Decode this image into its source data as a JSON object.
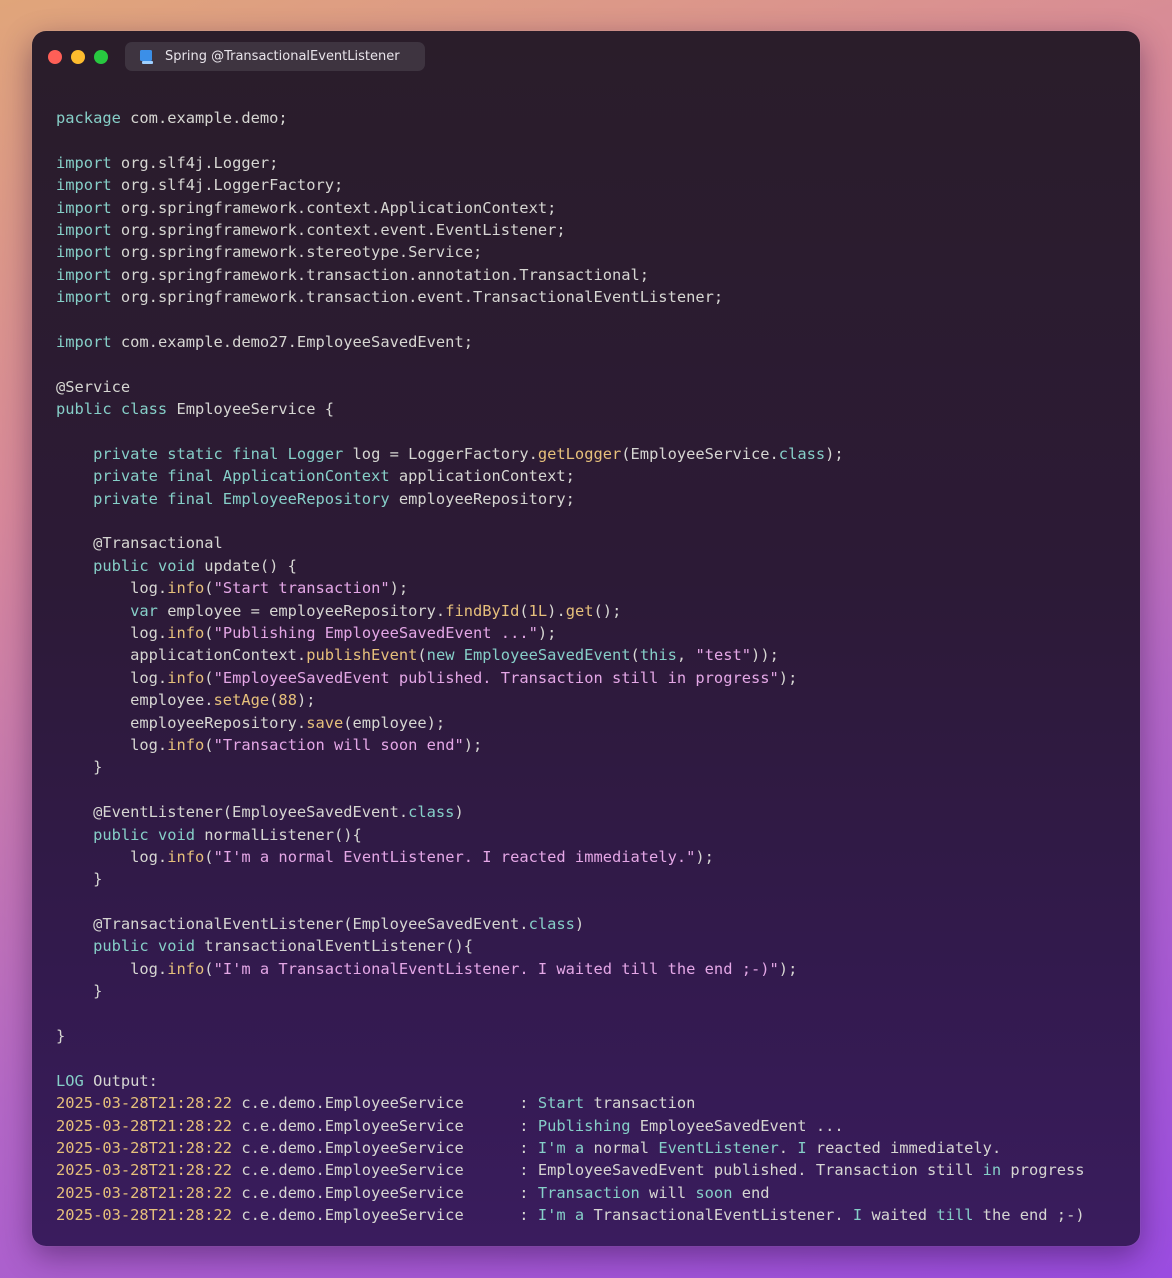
{
  "window": {
    "tab_title": "Spring @TransactionalEventListener",
    "tab_icon": "document-icon"
  },
  "code_lines": [
    [
      [
        "k",
        "package"
      ],
      [
        "n",
        " com.example.demo;"
      ]
    ],
    [],
    [
      [
        "k",
        "import"
      ],
      [
        "n",
        " org.slf4j.Logger;"
      ]
    ],
    [
      [
        "k",
        "import"
      ],
      [
        "n",
        " org.slf4j.LoggerFactory;"
      ]
    ],
    [
      [
        "k",
        "import"
      ],
      [
        "n",
        " org.springframework.context.ApplicationContext;"
      ]
    ],
    [
      [
        "k",
        "import"
      ],
      [
        "n",
        " org.springframework.context.event.EventListener;"
      ]
    ],
    [
      [
        "k",
        "import"
      ],
      [
        "n",
        " org.springframework.stereotype.Service;"
      ]
    ],
    [
      [
        "k",
        "import"
      ],
      [
        "n",
        " org.springframework.transaction.annotation.Transactional;"
      ]
    ],
    [
      [
        "k",
        "import"
      ],
      [
        "n",
        " org.springframework.transaction.event.TransactionalEventListener;"
      ]
    ],
    [],
    [
      [
        "k",
        "import"
      ],
      [
        "n",
        " com.example.demo27.EmployeeSavedEvent;"
      ]
    ],
    [],
    [
      [
        "n",
        "@Service"
      ]
    ],
    [
      [
        "k",
        "public class"
      ],
      [
        "n",
        " EmployeeService {"
      ]
    ],
    [],
    [
      [
        "n",
        "    "
      ],
      [
        "k",
        "private static final Logger"
      ],
      [
        "n",
        " log = LoggerFactory."
      ],
      [
        "m",
        "getLogger"
      ],
      [
        "n",
        "(EmployeeService."
      ],
      [
        "k",
        "class"
      ],
      [
        "n",
        ");"
      ]
    ],
    [
      [
        "n",
        "    "
      ],
      [
        "k",
        "private final ApplicationContext"
      ],
      [
        "n",
        " applicationContext;"
      ]
    ],
    [
      [
        "n",
        "    "
      ],
      [
        "k",
        "private final EmployeeRepository"
      ],
      [
        "n",
        " employeeRepository;"
      ]
    ],
    [],
    [
      [
        "n",
        "    @Transactional"
      ]
    ],
    [
      [
        "n",
        "    "
      ],
      [
        "k",
        "public void"
      ],
      [
        "n",
        " update() {"
      ]
    ],
    [
      [
        "n",
        "        log."
      ],
      [
        "m",
        "info"
      ],
      [
        "n",
        "("
      ],
      [
        "s",
        "\"Start transaction\""
      ],
      [
        "n",
        ");"
      ]
    ],
    [
      [
        "n",
        "        "
      ],
      [
        "k",
        "var"
      ],
      [
        "n",
        " employee = employeeRepository."
      ],
      [
        "m",
        "findById"
      ],
      [
        "n",
        "("
      ],
      [
        "m",
        "1L"
      ],
      [
        "n",
        ")."
      ],
      [
        "m",
        "get"
      ],
      [
        "n",
        "();"
      ]
    ],
    [
      [
        "n",
        "        log."
      ],
      [
        "m",
        "info"
      ],
      [
        "n",
        "("
      ],
      [
        "s",
        "\"Publishing EmployeeSavedEvent ...\""
      ],
      [
        "n",
        ");"
      ]
    ],
    [
      [
        "n",
        "        applicationContext."
      ],
      [
        "m",
        "publishEvent"
      ],
      [
        "n",
        "("
      ],
      [
        "k",
        "new EmployeeSavedEvent"
      ],
      [
        "n",
        "("
      ],
      [
        "k",
        "this"
      ],
      [
        "n",
        ", "
      ],
      [
        "s",
        "\"test\""
      ],
      [
        "n",
        "));"
      ]
    ],
    [
      [
        "n",
        "        log."
      ],
      [
        "m",
        "info"
      ],
      [
        "n",
        "("
      ],
      [
        "s",
        "\"EmployeeSavedEvent published. Transaction still in progress\""
      ],
      [
        "n",
        ");"
      ]
    ],
    [
      [
        "n",
        "        employee."
      ],
      [
        "m",
        "setAge"
      ],
      [
        "n",
        "("
      ],
      [
        "m",
        "88"
      ],
      [
        "n",
        ");"
      ]
    ],
    [
      [
        "n",
        "        employeeRepository."
      ],
      [
        "m",
        "save"
      ],
      [
        "n",
        "(employee);"
      ]
    ],
    [
      [
        "n",
        "        log."
      ],
      [
        "m",
        "info"
      ],
      [
        "n",
        "("
      ],
      [
        "s",
        "\"Transaction will soon end\""
      ],
      [
        "n",
        ");"
      ]
    ],
    [
      [
        "n",
        "    }"
      ]
    ],
    [],
    [
      [
        "n",
        "    @EventListener(EmployeeSavedEvent."
      ],
      [
        "k",
        "class"
      ],
      [
        "n",
        ")"
      ]
    ],
    [
      [
        "n",
        "    "
      ],
      [
        "k",
        "public void"
      ],
      [
        "n",
        " normalListener(){"
      ]
    ],
    [
      [
        "n",
        "        log."
      ],
      [
        "m",
        "info"
      ],
      [
        "n",
        "("
      ],
      [
        "s",
        "\"I'm a normal EventListener. I reacted immediately.\""
      ],
      [
        "n",
        ");"
      ]
    ],
    [
      [
        "n",
        "    }"
      ]
    ],
    [],
    [
      [
        "n",
        "    @TransactionalEventListener(EmployeeSavedEvent."
      ],
      [
        "k",
        "class"
      ],
      [
        "n",
        ")"
      ]
    ],
    [
      [
        "n",
        "    "
      ],
      [
        "k",
        "public void"
      ],
      [
        "n",
        " transactionalEventListener(){"
      ]
    ],
    [
      [
        "n",
        "        log."
      ],
      [
        "m",
        "info"
      ],
      [
        "n",
        "("
      ],
      [
        "s",
        "\"I'm a TransactionalEventListener. I waited till the end ;-)\""
      ],
      [
        "n",
        ");"
      ]
    ],
    [
      [
        "n",
        "    }"
      ]
    ],
    [],
    [
      [
        "n",
        "}"
      ]
    ],
    [],
    [
      [
        "k",
        "LOG"
      ],
      [
        "n",
        " Output:"
      ]
    ],
    [
      [
        "m",
        "2025-03-28T21:28:22"
      ],
      [
        "n",
        " c.e.demo.EmployeeService      : "
      ],
      [
        "k",
        "Start"
      ],
      [
        "n",
        " transaction"
      ]
    ],
    [
      [
        "m",
        "2025-03-28T21:28:22"
      ],
      [
        "n",
        " c.e.demo.EmployeeService      : "
      ],
      [
        "k",
        "Publishing"
      ],
      [
        "n",
        " EmployeeSavedEvent ..."
      ]
    ],
    [
      [
        "m",
        "2025-03-28T21:28:22"
      ],
      [
        "n",
        " c.e.demo.EmployeeService      : "
      ],
      [
        "k",
        "I'm a"
      ],
      [
        "n",
        " normal "
      ],
      [
        "k",
        "EventListener"
      ],
      [
        "n",
        ". "
      ],
      [
        "k",
        "I"
      ],
      [
        "n",
        " reacted immediately."
      ]
    ],
    [
      [
        "m",
        "2025-03-28T21:28:22"
      ],
      [
        "n",
        " c.e.demo.EmployeeService      : EmployeeSavedEvent published. Transaction still "
      ],
      [
        "k",
        "in"
      ],
      [
        "n",
        " progress"
      ]
    ],
    [
      [
        "m",
        "2025-03-28T21:28:22"
      ],
      [
        "n",
        " c.e.demo.EmployeeService      : "
      ],
      [
        "k",
        "Transaction"
      ],
      [
        "n",
        " will "
      ],
      [
        "k",
        "soon"
      ],
      [
        "n",
        " end"
      ]
    ],
    [
      [
        "m",
        "2025-03-28T21:28:22"
      ],
      [
        "n",
        " c.e.demo.EmployeeService      : "
      ],
      [
        "k",
        "I'm a"
      ],
      [
        "n",
        " TransactionalEventListener. "
      ],
      [
        "k",
        "I"
      ],
      [
        "n",
        " waited "
      ],
      [
        "k",
        "till"
      ],
      [
        "n",
        " the end ;-)"
      ]
    ]
  ]
}
